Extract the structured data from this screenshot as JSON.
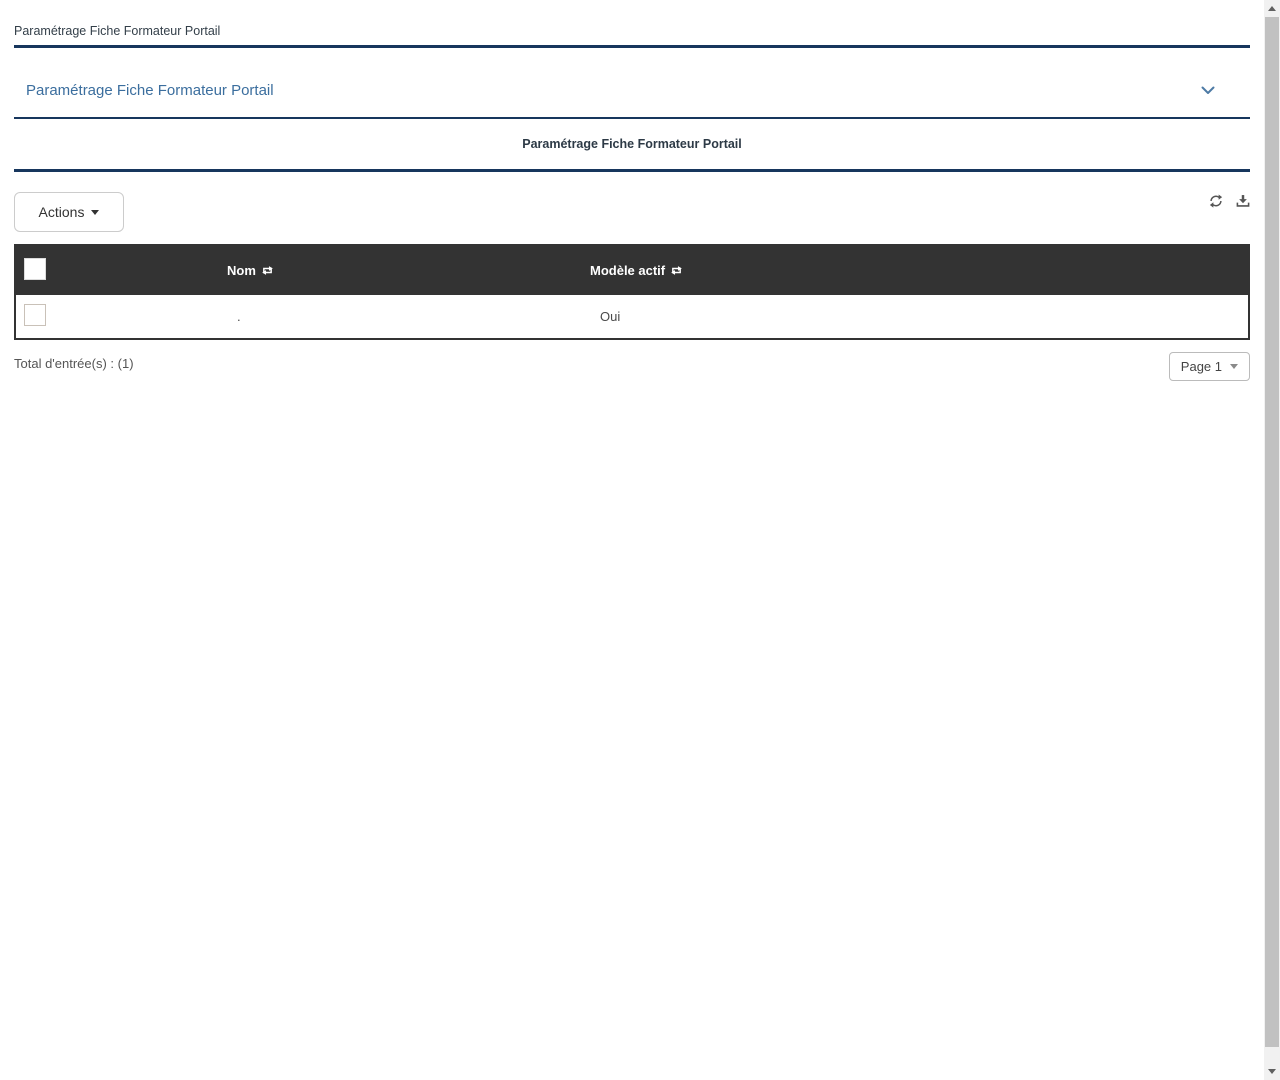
{
  "header": {
    "breadcrumb": "Paramétrage Fiche Formateur Portail"
  },
  "panel": {
    "title": "Paramétrage Fiche Formateur Portail",
    "chevron_icon": "chevron-down-icon"
  },
  "section": {
    "title": "Paramétrage Fiche Formateur Portail"
  },
  "toolbar": {
    "actions_label": "Actions",
    "refresh_icon": "refresh-icon",
    "download_icon": "download-icon"
  },
  "table": {
    "columns": [
      {
        "label": "Nom",
        "sort_icon": "sort-icon",
        "sortable": true
      },
      {
        "label": "Modèle actif",
        "sort_icon": "sort-icon",
        "sortable": true
      }
    ],
    "rows": [
      {
        "selected": false,
        "nom": ".",
        "modele_actif": "Oui"
      }
    ]
  },
  "footer": {
    "total": "Total d'entrée(s) : (1)",
    "page_selector": "Page 1"
  },
  "colors": {
    "accent_line": "#17365d",
    "panel_title_text": "#3b6e9e",
    "table_header_bg": "#333333",
    "table_header_text": "#ffffff",
    "scrollbar_track": "#f1f1f1",
    "scrollbar_thumb": "#c1c1c1"
  }
}
